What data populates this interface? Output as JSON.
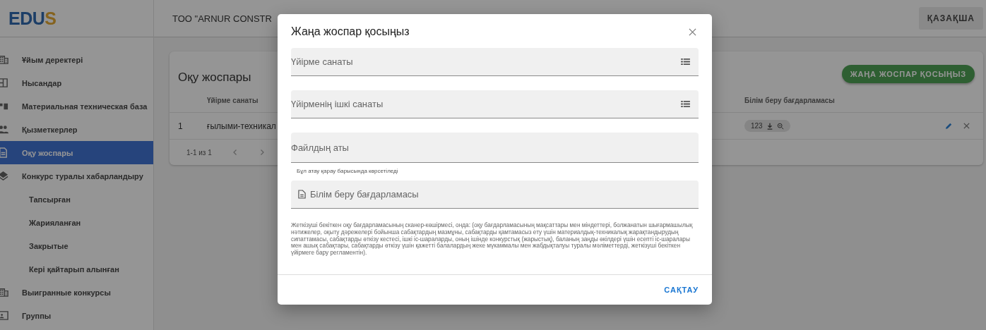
{
  "logo": {
    "main": "EDU",
    "accent": "S"
  },
  "header": {
    "title": "TOO \"ARNUR CONSTR",
    "language_button": "ҚАЗАҚША"
  },
  "sidebar": {
    "items": [
      {
        "label": "Ұйым деректері",
        "selected": false
      },
      {
        "label": "Нысандар",
        "selected": false
      },
      {
        "label": "Материальная техническая база",
        "selected": false
      },
      {
        "label": "Қызметкерлер",
        "selected": false
      },
      {
        "label": "Оқу жоспары",
        "selected": true
      },
      {
        "label": "Конкурс туралы хабарландыру",
        "selected": false,
        "children": [
          {
            "label": "Тапсырған",
            "selected": false
          },
          {
            "label": "Жарияланған",
            "selected": false
          },
          {
            "label": "Закрытые",
            "selected": false
          },
          {
            "label": "Кері қайтарып алынған",
            "selected": false
          }
        ]
      },
      {
        "label": "Выигранные конкурсы",
        "selected": false
      },
      {
        "label": "Группы",
        "selected": false
      }
    ]
  },
  "card": {
    "title": "Оқу жоспары",
    "add_button": "ЖАҢА ЖОСПАР ҚОСЫҢЫЗ",
    "columns": [
      "Үйірме санаты",
      "Білім беру бағдарламасы"
    ],
    "rows": [
      {
        "number": "1",
        "category": "ғылыми-техникал",
        "file_chip": "123"
      }
    ],
    "pagination": "1-1 из 1"
  },
  "dialog": {
    "title": "Жаңа жоспар қосыңыз",
    "fields": [
      {
        "kind": "select",
        "label": "Үйірме санаты"
      },
      {
        "kind": "select",
        "label": "Үйірменің ішкі санаты"
      },
      {
        "kind": "text",
        "placeholder": "Файлдың аты",
        "hint": "Бұл атау қарау барысында көрсетіледі"
      },
      {
        "kind": "file",
        "label": "Білім беру бағдарламасы"
      }
    ],
    "description": "Жеткізуші бекіткен оқу бағдарламасының сканер-көшірмесі, онда: (оқу бағдарламасының мақсаттары мен міндеттері, болжанатын шығармашылық нәтижелер, оқыту дәрежелері бойынша сабақтардың мазмұны, сабақтарды қамтамасыз ету үшін материалдық-техникалық жарақтандырудың сипаттамасы, сабақтарды өткізу кестесі, ішкі іс-шараларды, оның ішінде конкурстық (жарыстық), баланың заңды өкілдері үшін есепті іс-шаралары мен ашық сабақтары, сабақтарды өткізу үшін қажетті балалардың жеке мүкаммалы мен жабдықталуы туралы мәліметтерді, жеткізуші бекіткен үйірмеге бару регламентін).",
    "save_button": "САҚТАУ"
  }
}
